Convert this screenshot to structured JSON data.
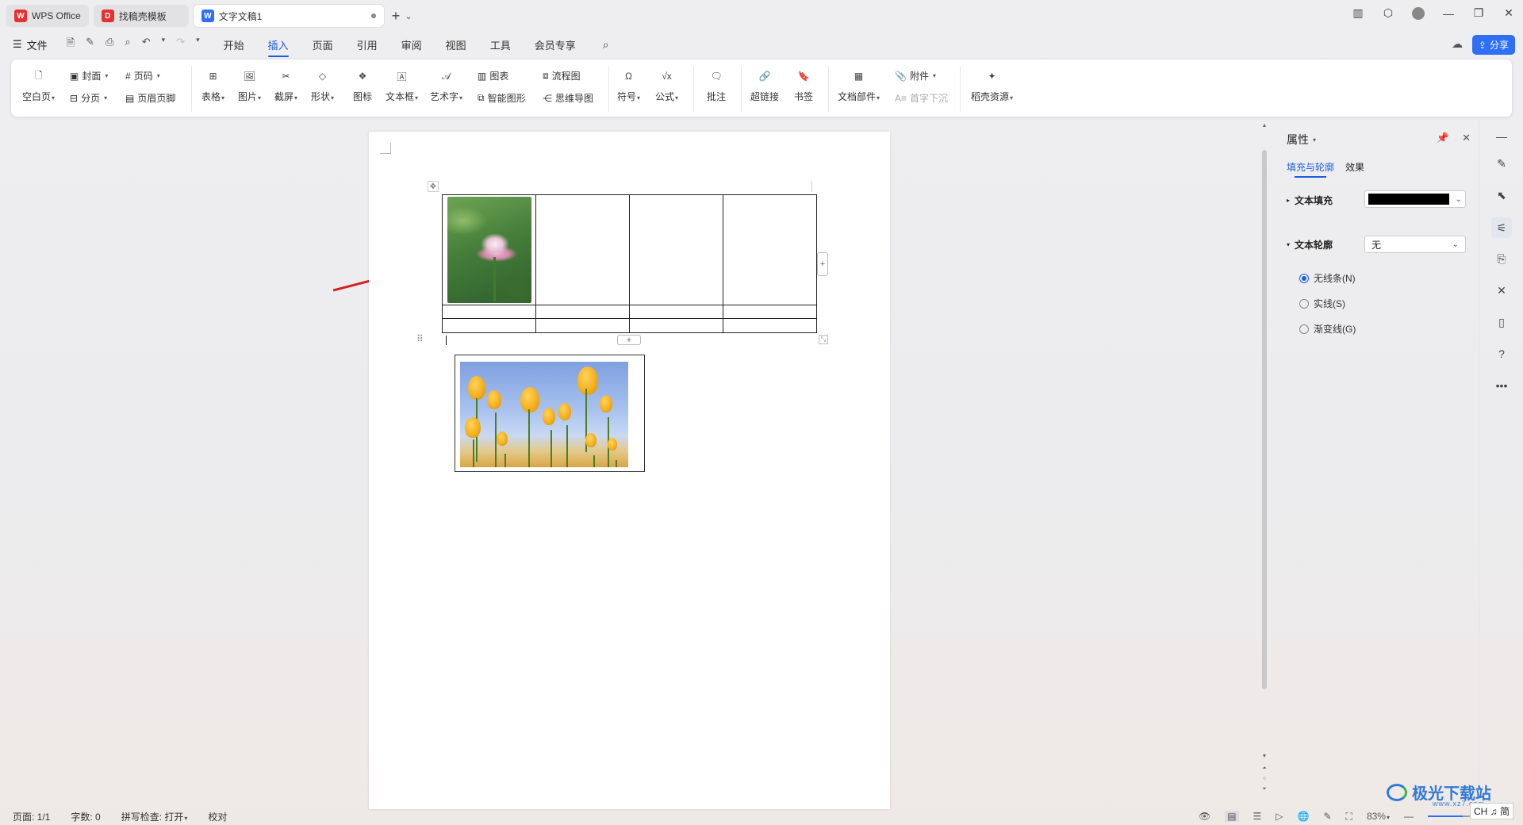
{
  "tabs": [
    {
      "label": "WPS Office",
      "logo": "W",
      "logo_color": "#e5312f"
    },
    {
      "label": "找稿壳模板",
      "logo": "D",
      "logo_color": "#e5312f"
    },
    {
      "label": "文字文稿1",
      "logo": "W",
      "logo_color": "#2f6ff5"
    }
  ],
  "menubar": {
    "file_label": "文件",
    "tabs": [
      "开始",
      "插入",
      "页面",
      "引用",
      "审阅",
      "视图",
      "工具",
      "会员专享"
    ],
    "active_tab": "插入",
    "share_label": "分享"
  },
  "ribbon": {
    "blank_page": "空白页",
    "cover": "封面",
    "page_break": "分页",
    "page_number": "页码",
    "header_footer": "页眉页脚",
    "table": "表格",
    "picture": "图片",
    "screenshot": "截屏",
    "shape": "形状",
    "icon": "图标",
    "textbox": "文本框",
    "wordart": "艺术字",
    "chart": "图表",
    "smart_graphic": "智能图形",
    "flowchart": "流程图",
    "mindmap": "思维导图",
    "symbol": "符号",
    "formula": "公式",
    "comment": "批注",
    "hyperlink": "超链接",
    "bookmark": "书签",
    "doc_parts": "文档部件",
    "attachment": "附件",
    "drop_cap": "首字下沉",
    "resources": "稻壳资源"
  },
  "panel": {
    "title": "属性",
    "tabs": [
      "填充与轮廓",
      "效果"
    ],
    "active_tab": "填充与轮廓",
    "text_fill_label": "文本填充",
    "text_fill_color": "#000000",
    "text_outline_label": "文本轮廓",
    "text_outline_value": "无",
    "radio_options": [
      "无线条(N)",
      "实线(S)",
      "渐变线(G)"
    ],
    "radio_selected": "无线条(N)"
  },
  "status": {
    "page": "页面: 1/1",
    "word_count": "字数: 0",
    "spellcheck": "拼写检查: 打开",
    "proofread": "校对",
    "zoom": "83%"
  },
  "watermark": {
    "brand": "极光下载站",
    "url": "www.xz7.com",
    "ime": "CH ♫ 简"
  },
  "colors": {
    "accent": "#1a5ce0",
    "share_bg": "#2f6ff5",
    "arrow": "#d82020"
  }
}
